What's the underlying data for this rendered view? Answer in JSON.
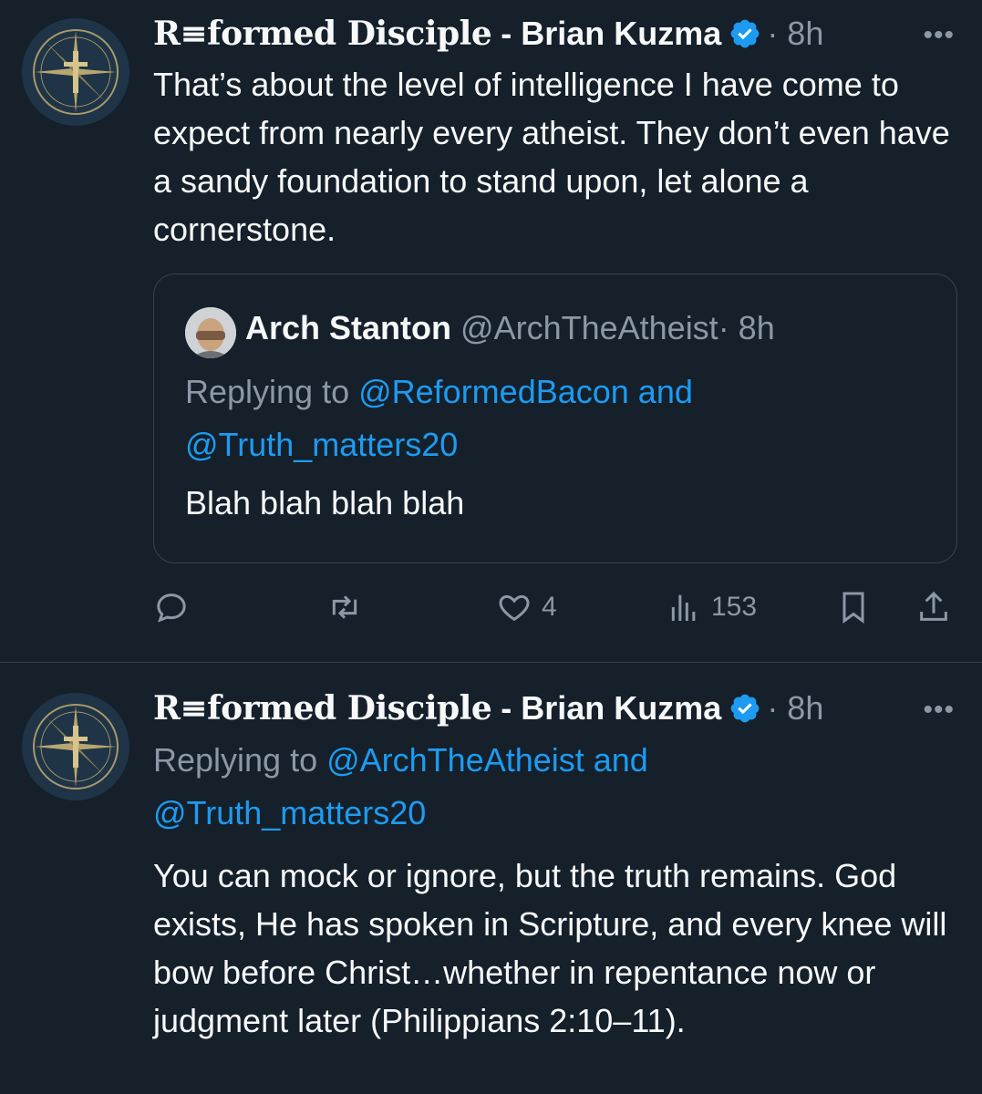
{
  "tweet1": {
    "author_name_stylized": "R≡formed Disciple",
    "author_name_rest": " - Brian Kuzma",
    "time": "· 8h",
    "more": "•••",
    "text": "That’s about the level of intelligence I have come to expect from nearly every atheist.  They don’t even have a sandy foundation to stand upon, let alone a cornerstone.",
    "quote": {
      "name": "Arch Stanton",
      "handle": "@ArchTheAtheist",
      "time": "· 8h",
      "replying_prefix": "Replying to ",
      "replying_handles": "@ReformedBacon and",
      "replying_handles_2": "@Truth_matters20",
      "text": "Blah blah blah blah"
    },
    "actions": {
      "reply_count": "",
      "retweet_count": "",
      "like_count": "4",
      "views_count": "153"
    }
  },
  "tweet2": {
    "author_name_stylized": "R≡formed Disciple",
    "author_name_rest": " - Brian Kuzma",
    "time": "· 8h",
    "more": "•••",
    "replying_prefix": "Replying to ",
    "replying_handles": "@ArchTheAtheist and",
    "replying_handles_2": "@Truth_matters20",
    "text": "You can mock or ignore, but the truth remains. God exists, He has spoken in Scripture, and every knee will bow before Christ…whether in repentance now or judgment later (Philippians 2:10–11)."
  },
  "colors": {
    "background": "#15202b",
    "accent": "#1d9bf0",
    "muted": "#8b98a5",
    "border": "#38444d"
  }
}
